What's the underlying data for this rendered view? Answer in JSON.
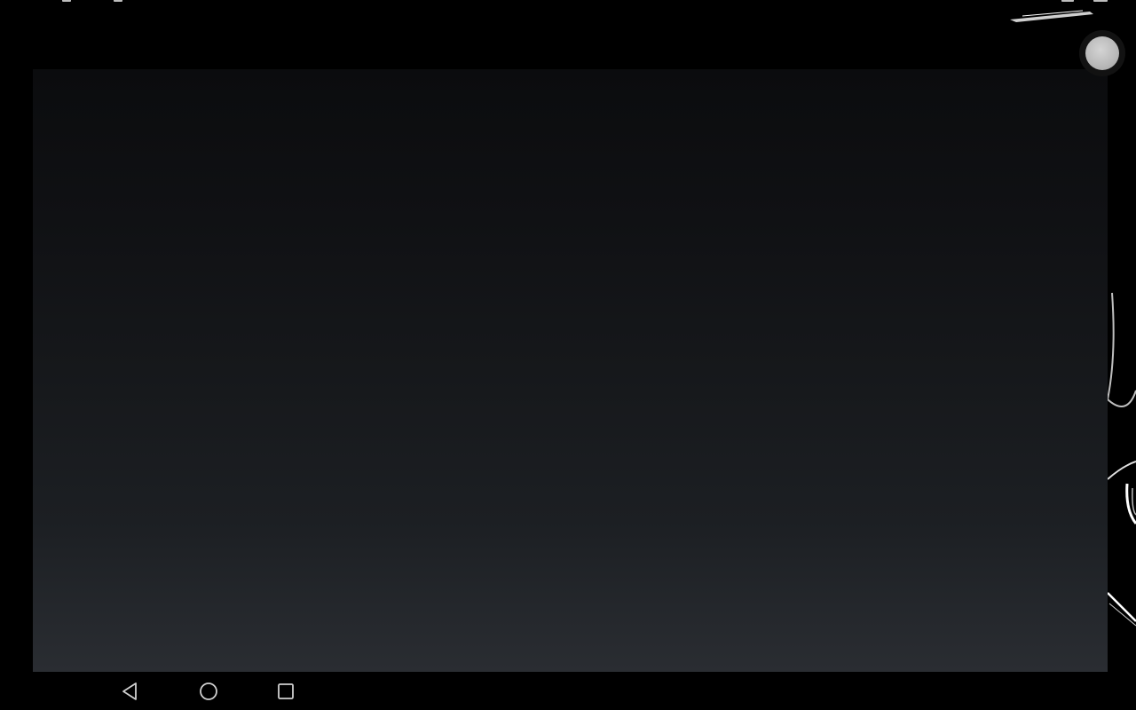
{
  "status_bar": {
    "icons": [
      "notification-icon",
      "notification-icon",
      "signal-icon",
      "battery-icon"
    ]
  },
  "content_panel": {
    "gradient_top": "#0b0c0e",
    "gradient_bottom": "#2a2d32"
  },
  "floating_button": {
    "icon": "circle-icon",
    "color": "#bdbdbd"
  },
  "nav_bar": {
    "buttons": [
      {
        "name": "back",
        "icon": "back-triangle-icon"
      },
      {
        "name": "home",
        "icon": "home-circle-icon"
      },
      {
        "name": "recents",
        "icon": "recents-square-icon"
      }
    ],
    "icon_color": "#d0d0d0"
  }
}
